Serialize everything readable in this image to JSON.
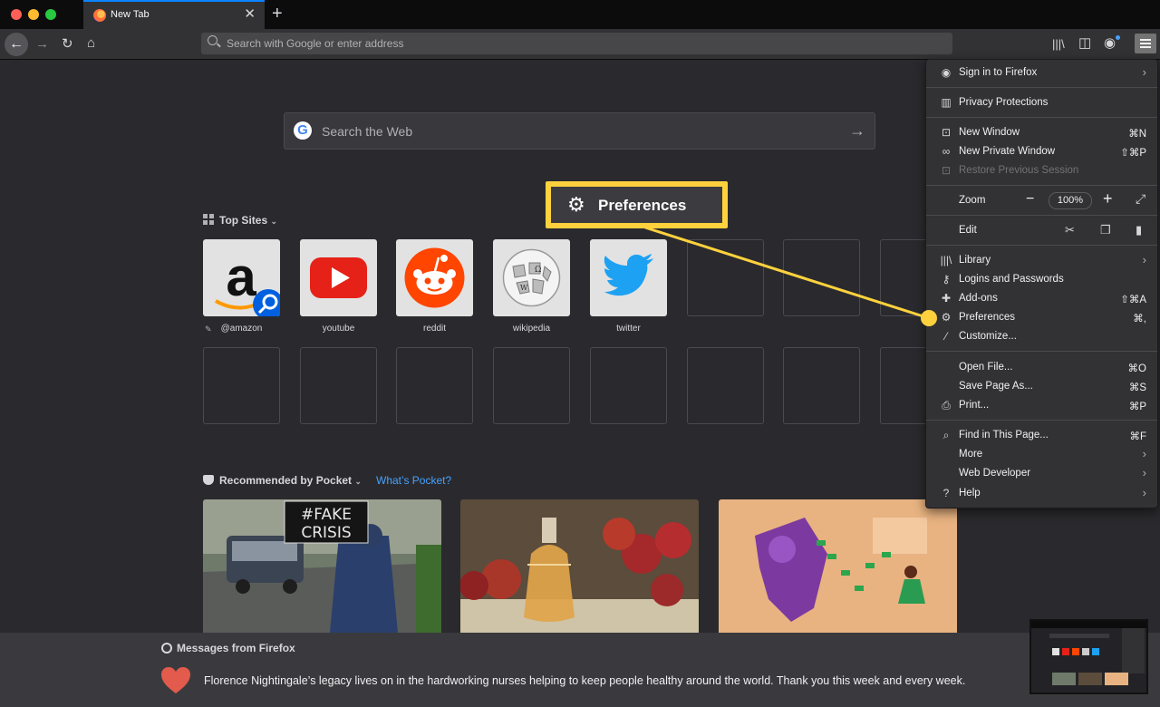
{
  "browser": {
    "tab_title": "New Tab",
    "tab_close": "✕",
    "new_tab": "+",
    "address_placeholder": "Search with Google or enter address"
  },
  "newtab": {
    "search_placeholder": "Search the Web",
    "top_sites_label": "Top Sites",
    "top_sites": [
      {
        "label": "@amazon",
        "icon": "amazon-logo"
      },
      {
        "label": "youtube",
        "icon": "youtube-logo"
      },
      {
        "label": "reddit",
        "icon": "reddit-logo"
      },
      {
        "label": "wikipedia",
        "icon": "wikipedia-logo"
      },
      {
        "label": "twitter",
        "icon": "twitter-logo"
      }
    ],
    "pocket_label": "Recommended by Pocket",
    "whats_pocket": "What’s Pocket?",
    "fake_crisis_sign": "#FAKE CRISIS",
    "messages_title": "Messages from Firefox",
    "message_text": "Florence Nightingale’s legacy lives on in the hardworking nurses helping to keep people healthy around the world. Thank you this week and every week."
  },
  "app_menu": {
    "sign_in": "Sign in to Firefox",
    "privacy": "Privacy Protections",
    "new_window": {
      "label": "New Window",
      "shortcut": "⌘N"
    },
    "new_private_window": {
      "label": "New Private Window",
      "shortcut": "⇧⌘P"
    },
    "restore_session": "Restore Previous Session",
    "zoom": {
      "label": "Zoom",
      "minus": "−",
      "value": "100%",
      "plus": "+"
    },
    "edit": "Edit",
    "library": "Library",
    "logins": "Logins and Passwords",
    "addons": {
      "label": "Add-ons",
      "shortcut": "⇧⌘A"
    },
    "preferences": {
      "label": "Preferences",
      "shortcut": "⌘,"
    },
    "customize": "Customize...",
    "open_file": {
      "label": "Open File...",
      "shortcut": "⌘O"
    },
    "save_page": {
      "label": "Save Page As...",
      "shortcut": "⌘S"
    },
    "print": {
      "label": "Print...",
      "shortcut": "⌘P"
    },
    "find": {
      "label": "Find in This Page...",
      "shortcut": "⌘F"
    },
    "more": "More",
    "web_developer": "Web Developer",
    "help": "Help"
  },
  "callout": {
    "label": "Preferences"
  },
  "colors": {
    "accent_yellow": "#ffd23d",
    "link_blue": "#45a1ff",
    "background": "#2a2a2e"
  }
}
